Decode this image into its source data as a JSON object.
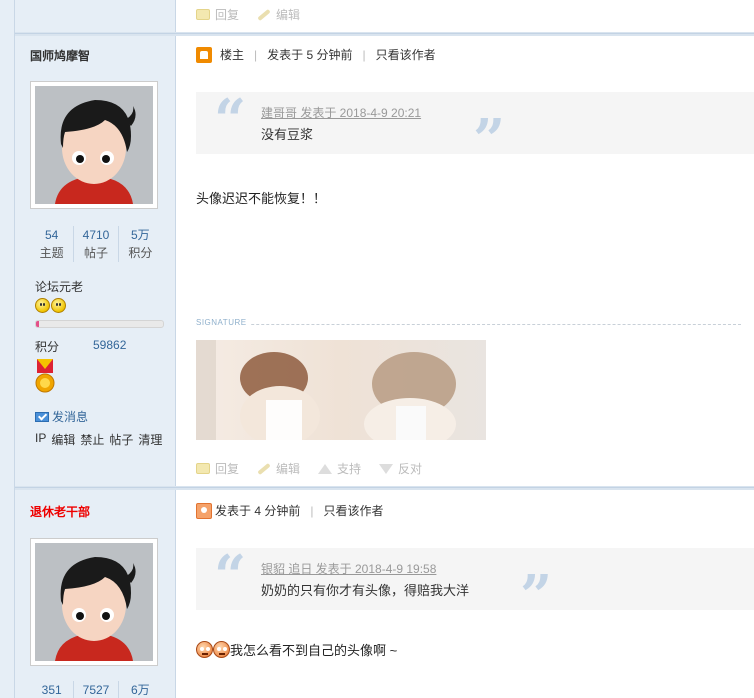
{
  "top_actions": {
    "reply": "回复",
    "edit": "编辑"
  },
  "posts": [
    {
      "username": "国师鸠摩智",
      "stats": [
        {
          "num": "54",
          "label": "主题"
        },
        {
          "num": "4710",
          "label": "帖子"
        },
        {
          "num": "5万",
          "label": "积分"
        }
      ],
      "rank": "论坛元老",
      "rank_progress": 0.02,
      "score_label": "积分",
      "score_value": "59862",
      "send_message": "发消息",
      "admin_links": [
        "IP",
        "编辑",
        "禁止",
        "帖子",
        "清理"
      ],
      "louzhu": "楼主",
      "posted": "发表于 5 分钟前",
      "only_author": "只看该作者",
      "quote_author": "建哥哥 发表于 2018-4-9 20:21",
      "quote_text": "没有豆浆",
      "message": "头像迟迟不能恢复！！",
      "signature_label": "SIGNATURE",
      "actions": {
        "reply": "回复",
        "edit": "编辑",
        "support": "支持",
        "oppose": "反对"
      }
    },
    {
      "username": "退休老干部",
      "username_color": "#ee0000",
      "stats": [
        {
          "num": "351",
          "label": ""
        },
        {
          "num": "7527",
          "label": ""
        },
        {
          "num": "6万",
          "label": ""
        }
      ],
      "posted": "发表于 4 分钟前",
      "only_author": "只看该作者",
      "quote_author": " 银貂 追日 发表于 2018-4-9 19:58",
      "quote_text": "奶奶的只有你才有头像，得赔我大洋",
      "message": "我怎么看不到自己的头像啊 ~"
    }
  ]
}
